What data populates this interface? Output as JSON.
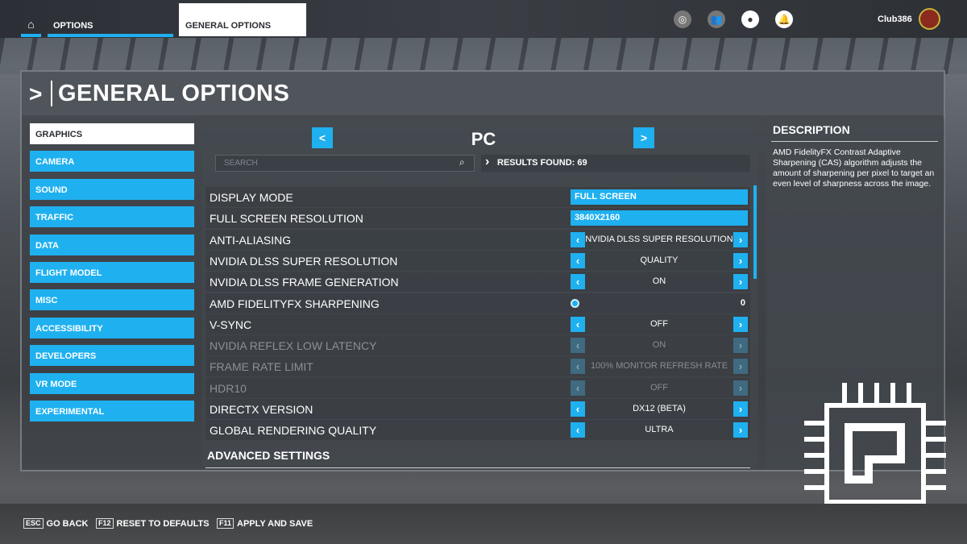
{
  "topbar": {
    "breadcrumb": [
      "OPTIONS",
      "GENERAL OPTIONS"
    ],
    "username": "Club386",
    "icons": [
      "activity-icon",
      "friends-icon",
      "profile-icon",
      "notification-icon"
    ]
  },
  "page_title": "GENERAL OPTIONS",
  "sidebar": {
    "items": [
      {
        "label": "GRAPHICS",
        "active": true
      },
      {
        "label": "CAMERA"
      },
      {
        "label": "SOUND"
      },
      {
        "label": "TRAFFIC"
      },
      {
        "label": "DATA"
      },
      {
        "label": "FLIGHT MODEL"
      },
      {
        "label": "MISC"
      },
      {
        "label": "ACCESSIBILITY"
      },
      {
        "label": "DEVELOPERS"
      },
      {
        "label": "VR MODE"
      },
      {
        "label": "EXPERIMENTAL"
      }
    ]
  },
  "main": {
    "platform": "PC",
    "search_placeholder": "SEARCH",
    "results": "RESULTS FOUND: 69",
    "settings": [
      {
        "label": "DISPLAY MODE",
        "type": "dropdown",
        "value": "FULL SCREEN"
      },
      {
        "label": "FULL SCREEN RESOLUTION",
        "type": "dropdown",
        "value": "3840X2160"
      },
      {
        "label": "ANTI-ALIASING",
        "type": "selector",
        "value": "NVIDIA DLSS SUPER RESOLUTION"
      },
      {
        "label": "NVIDIA DLSS SUPER RESOLUTION",
        "type": "selector",
        "value": "QUALITY"
      },
      {
        "label": "NVIDIA DLSS FRAME GENERATION",
        "type": "selector",
        "value": "ON"
      },
      {
        "label": "AMD FIDELITYFX SHARPENING",
        "type": "slider",
        "value": "0"
      },
      {
        "label": "V-SYNC",
        "type": "selector",
        "value": "OFF"
      },
      {
        "label": "NVIDIA REFLEX LOW LATENCY",
        "type": "selector",
        "value": "ON",
        "disabled": true
      },
      {
        "label": "FRAME RATE LIMIT",
        "type": "selector",
        "value": "100% MONITOR REFRESH RATE",
        "disabled": true
      },
      {
        "label": "HDR10",
        "type": "selector",
        "value": "OFF",
        "disabled": true
      },
      {
        "label": "DIRECTX VERSION",
        "type": "selector",
        "value": "DX12 (BETA)"
      },
      {
        "label": "GLOBAL RENDERING QUALITY",
        "type": "selector",
        "value": "ULTRA"
      }
    ],
    "advanced": "ADVANCED SETTINGS"
  },
  "description": {
    "title": "DESCRIPTION",
    "text": "AMD FidelityFX Contrast Adaptive Sharpening (CAS) algorithm adjusts the amount of sharpening per pixel to target an even level of sharpness across the image."
  },
  "footer": [
    {
      "key": "ESC",
      "label": "GO BACK"
    },
    {
      "key": "F12",
      "label": "RESET TO DEFAULTS"
    },
    {
      "key": "F11",
      "label": "APPLY AND SAVE"
    }
  ],
  "colors": {
    "accent": "#1fb0f0"
  }
}
